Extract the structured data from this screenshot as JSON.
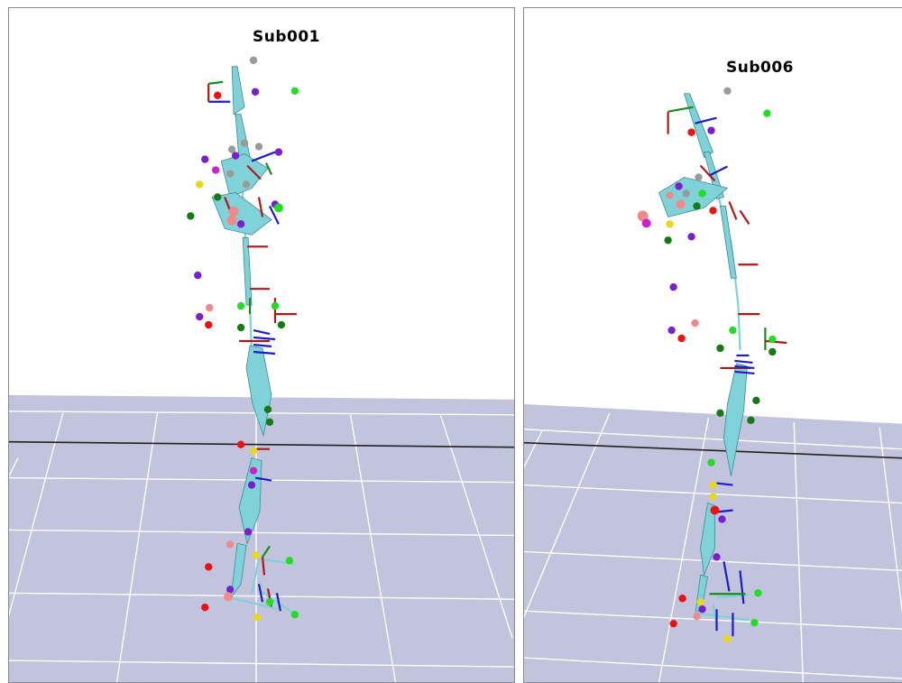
{
  "viewports": [
    {
      "subject": "Sub001"
    },
    {
      "subject": "Sub006"
    }
  ],
  "colors": {
    "background": "#ffffff",
    "floor": "#c2c3dd",
    "grid": "#ffffff",
    "horizon": "#222222",
    "bone": "#7fd3d8",
    "bone_edge": "#3a8c95",
    "axis_red": "#b01818",
    "axis_green": "#1a8a1a",
    "axis_blue": "#1c1ccc",
    "marker_red": "#ee1111",
    "marker_green": "#22dd22",
    "marker_darkgreen": "#147a14",
    "marker_purple": "#7a1fd0",
    "marker_magenta": "#cc22cc",
    "marker_yellow": "#e8d81a",
    "marker_pink": "#f08a8a",
    "marker_gray": "#9a9a9a"
  }
}
